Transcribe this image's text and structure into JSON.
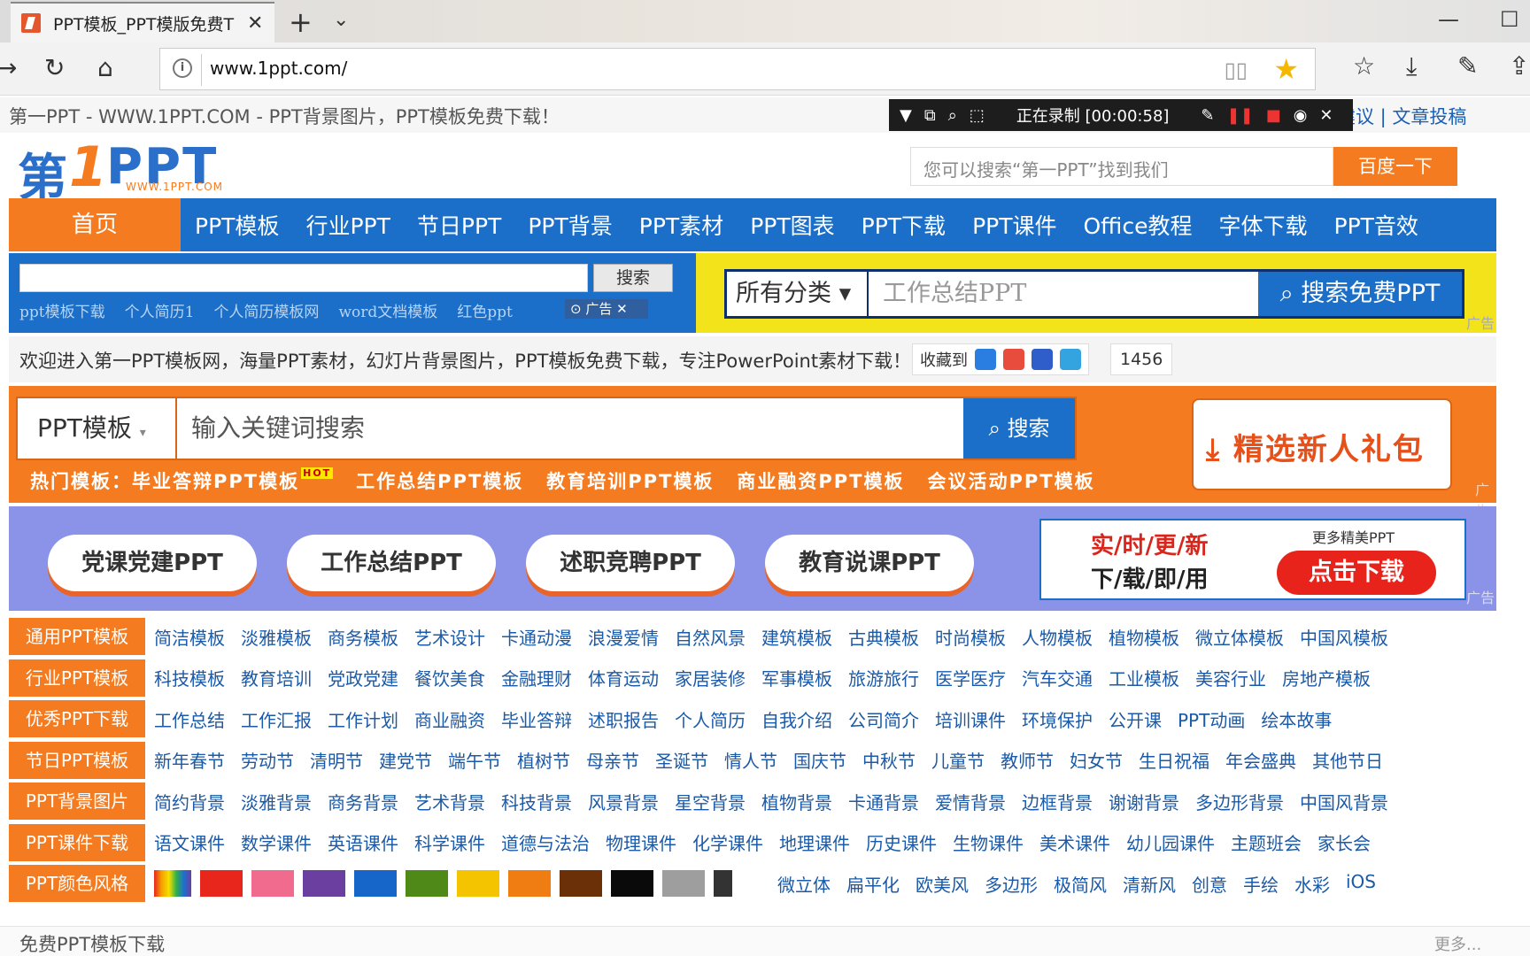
{
  "browser": {
    "tab_title": "PPT模板_PPT模版免费T",
    "url": "www.1ppt.com/",
    "new_tab": "+",
    "tab_menu": "⌵"
  },
  "page": {
    "top_text": "第一PPT - WWW.1PPT.COM - PPT背景图片，PPT模板免费下载！",
    "top_links": "建议  | 文章投稿",
    "recorder_text": "正在录制 [00:00:58]",
    "logo": {
      "part1": "第",
      "part2": "1",
      "part3": "PPT",
      "small": "WWW.1PPT.COM"
    },
    "baidu_placeholder": "您可以搜索“第一PPT”找到我们",
    "baidu_button": "百度一下",
    "nav": {
      "home": "首页",
      "items": [
        "PPT模板",
        "行业PPT",
        "节日PPT",
        "PPT背景",
        "PPT素材",
        "PPT图表",
        "PPT下载",
        "PPT课件",
        "Office教程",
        "字体下载",
        "PPT音效"
      ]
    },
    "small_search": {
      "button": "搜索",
      "hot": [
        "ppt模板下载",
        "个人简历1",
        "个人简历模板网",
        "word文档模板",
        "红色ppt"
      ],
      "ad": "广告"
    },
    "yellow_search": {
      "category": "所有分类",
      "keyword": "工作总结PPT",
      "button": "搜索免费PPT"
    },
    "ad_label": "广告",
    "welcome": "欢迎进入第一PPT模板网，海量PPT素材，幻灯片背景图片，PPT模板免费下载，专注PowerPoint素材下载！",
    "favorite_label": "收藏到",
    "favorite_count": "1456",
    "orange_search": {
      "category": "PPT模板",
      "placeholder": "输入关键词搜索",
      "button": "搜索",
      "hot_label": "热门模板：毕业答辩PPT模板",
      "hot_badge": "HOT",
      "hot_items": [
        "工作总结PPT模板",
        "教育培训PPT模板",
        "商业融资PPT模板",
        "会议活动PPT模板"
      ],
      "gift": "精选新人礼包"
    },
    "promo": {
      "pills": [
        "党课党建PPT",
        "工作总结PPT",
        "述职竞聘PPT",
        "教育说课PPT"
      ],
      "banner_a": "实/时/更/新",
      "banner_b": "下/载/即/用",
      "banner_c": "更多精美PPT",
      "banner_btn": "点击下载"
    },
    "categories": [
      {
        "label": "通用PPT模板",
        "links": [
          "简洁模板",
          "淡雅模板",
          "商务模板",
          "艺术设计",
          "卡通动漫",
          "浪漫爱情",
          "自然风景",
          "建筑模板",
          "古典模板",
          "时尚模板",
          "人物模板",
          "植物模板",
          "微立体模板",
          "中国风模板"
        ]
      },
      {
        "label": "行业PPT模板",
        "links": [
          "科技模板",
          "教育培训",
          "党政党建",
          "餐饮美食",
          "金融理财",
          "体育运动",
          "家居装修",
          "军事模板",
          "旅游旅行",
          "医学医疗",
          "汽车交通",
          "工业模板",
          "美容行业",
          "房地产模板"
        ]
      },
      {
        "label": "优秀PPT下载",
        "links": [
          "工作总结",
          "工作汇报",
          "工作计划",
          "商业融资",
          "毕业答辩",
          "述职报告",
          "个人简历",
          "自我介绍",
          "公司简介",
          "培训课件",
          "环境保护",
          "公开课",
          "PPT动画",
          "绘本故事"
        ]
      },
      {
        "label": "节日PPT模板",
        "links": [
          "新年春节",
          "劳动节",
          "清明节",
          "建党节",
          "端午节",
          "植树节",
          "母亲节",
          "圣诞节",
          "情人节",
          "国庆节",
          "中秋节",
          "儿童节",
          "教师节",
          "妇女节",
          "生日祝福",
          "年会盛典",
          "其他节日"
        ]
      },
      {
        "label": "PPT背景图片",
        "links": [
          "简约背景",
          "淡雅背景",
          "商务背景",
          "艺术背景",
          "科技背景",
          "风景背景",
          "星空背景",
          "植物背景",
          "卡通背景",
          "爱情背景",
          "边框背景",
          "谢谢背景",
          "多边形背景",
          "中国风背景"
        ]
      },
      {
        "label": "PPT课件下载",
        "links": [
          "语文课件",
          "数学课件",
          "英语课件",
          "科学课件",
          "道德与法治",
          "物理课件",
          "化学课件",
          "地理课件",
          "历史课件",
          "生物课件",
          "美术课件",
          "幼儿园课件",
          "主题班会",
          "家长会"
        ]
      }
    ],
    "color_row": {
      "label": "PPT颜色风格",
      "colors": [
        "#e8261c",
        "#f06b8e",
        "#6b3fa0",
        "#1566c8",
        "#4f8a18",
        "#f5c400",
        "#f07d12",
        "#6b3008",
        "#0a0a0a",
        "#9e9e9e",
        "#333333"
      ],
      "styles": [
        "微立体",
        "扁平化",
        "欧美风",
        "多边形",
        "极简风",
        "清新风",
        "创意",
        "手绘",
        "水彩",
        "iOS"
      ]
    },
    "footer_left": "免费PPT模板下载",
    "footer_right": "更多..."
  }
}
